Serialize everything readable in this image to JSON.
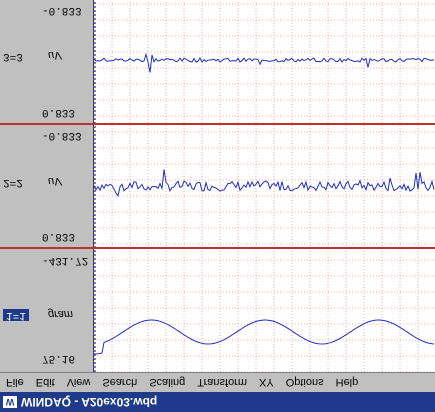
{
  "window": {
    "app_icon_text": "W",
    "title": "WINDAQ - A20ex03.wdq"
  },
  "menu": {
    "items": [
      "File",
      "Edit",
      "View",
      "Search",
      "Scaling",
      "Transform",
      "XY",
      "Options",
      "Help"
    ]
  },
  "channels": [
    {
      "name": "1=1",
      "units": "gram",
      "top_value": "75.16",
      "bottom_value": "-431.72",
      "active": true
    },
    {
      "name": "2=2",
      "units": "uV",
      "top_value": "0.833",
      "bottom_value": "-0.833",
      "active": false
    },
    {
      "name": "3=3",
      "units": "uV",
      "top_value": "0.833",
      "bottom_value": "-0.833",
      "active": false
    }
  ],
  "colors": {
    "background": "#ffffff",
    "trace": "#2030c0",
    "grid": "#e07070",
    "separator": "#c03030",
    "panel": "#c0c0c0",
    "titlebar": "#1f3a8a"
  }
}
